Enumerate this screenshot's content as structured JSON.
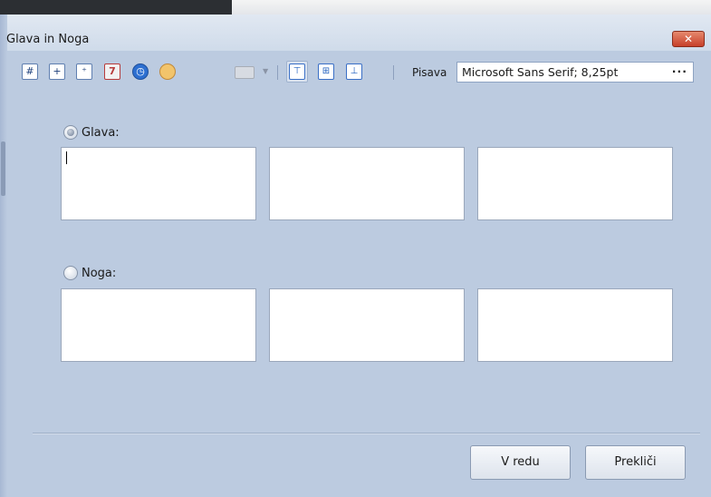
{
  "window": {
    "title": "Glava in Noga",
    "close_label": "✕"
  },
  "toolbar": {
    "icons": [
      "page-number-icon",
      "page-count-icon",
      "page-of-icon",
      "date-icon",
      "time-icon",
      "user-icon",
      "picture-icon",
      "align-top-icon",
      "align-middle-icon",
      "align-bottom-icon"
    ],
    "font_label": "Pisava",
    "font_value": "Microsoft Sans Serif; 8,25pt",
    "more_label": "···"
  },
  "header_section": {
    "label": "Glava:",
    "selected": true
  },
  "footer_section": {
    "label": "Noga:",
    "selected": false
  },
  "buttons": {
    "ok": "V redu",
    "cancel": "Prekliči"
  },
  "colors": {
    "dialog_bg": "#bccbe0",
    "close_button": "#c7402a"
  }
}
